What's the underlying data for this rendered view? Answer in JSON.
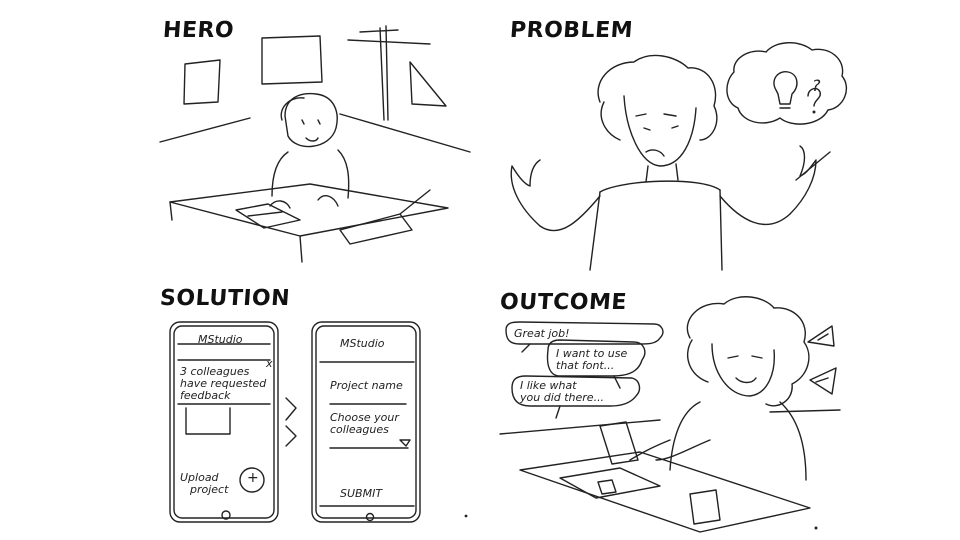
{
  "panels": {
    "hero": {
      "title": "HERO"
    },
    "problem": {
      "title": "PROBLEM"
    },
    "solution": {
      "title": "SOLUTION",
      "phone1": {
        "app_name": "MStudio",
        "close": "x",
        "notification_line1": "3 colleagues",
        "notification_line2": "have requested",
        "notification_line3": "feedback",
        "upload_line1": "Upload",
        "upload_line2": "project",
        "plus": "+"
      },
      "phone2": {
        "app_name": "MStudio",
        "field1": "Project name",
        "field2_line1": "Choose your",
        "field2_line2": "colleagues",
        "submit": "SUBMIT"
      }
    },
    "outcome": {
      "title": "OUTCOME",
      "bubble1": "Great job!",
      "bubble2_line1": "I want to use",
      "bubble2_line2": "that font...",
      "bubble3_line1": "I like what",
      "bubble3_line2": "you did there..."
    }
  },
  "icons": {
    "idea": "lightbulb-icon",
    "question": "?"
  }
}
